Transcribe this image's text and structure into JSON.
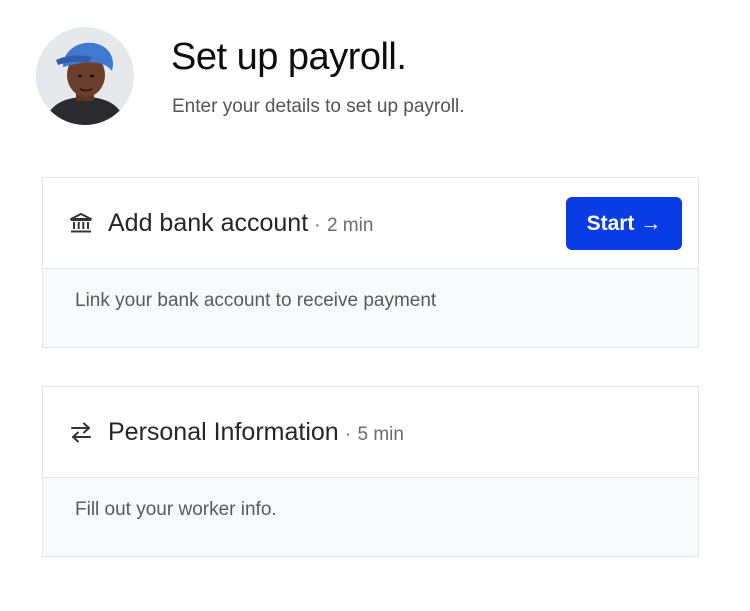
{
  "header": {
    "title": "Set up payroll.",
    "subtitle": "Enter your details to set up payroll."
  },
  "cards": [
    {
      "icon": "bank-icon",
      "title": "Add bank account",
      "separator": "·",
      "time": "2 min",
      "description": "Link your bank account to receive payment",
      "button_label": "Start",
      "button_arrow": "→"
    },
    {
      "icon": "swap-arrows-icon",
      "title": "Personal Information",
      "separator": "·",
      "time": "5 min",
      "description": "Fill out your worker info."
    }
  ],
  "colors": {
    "accent": "#0a3ce6",
    "card_border": "#e3e5e8",
    "card_footer_bg": "#f8f9fa"
  }
}
